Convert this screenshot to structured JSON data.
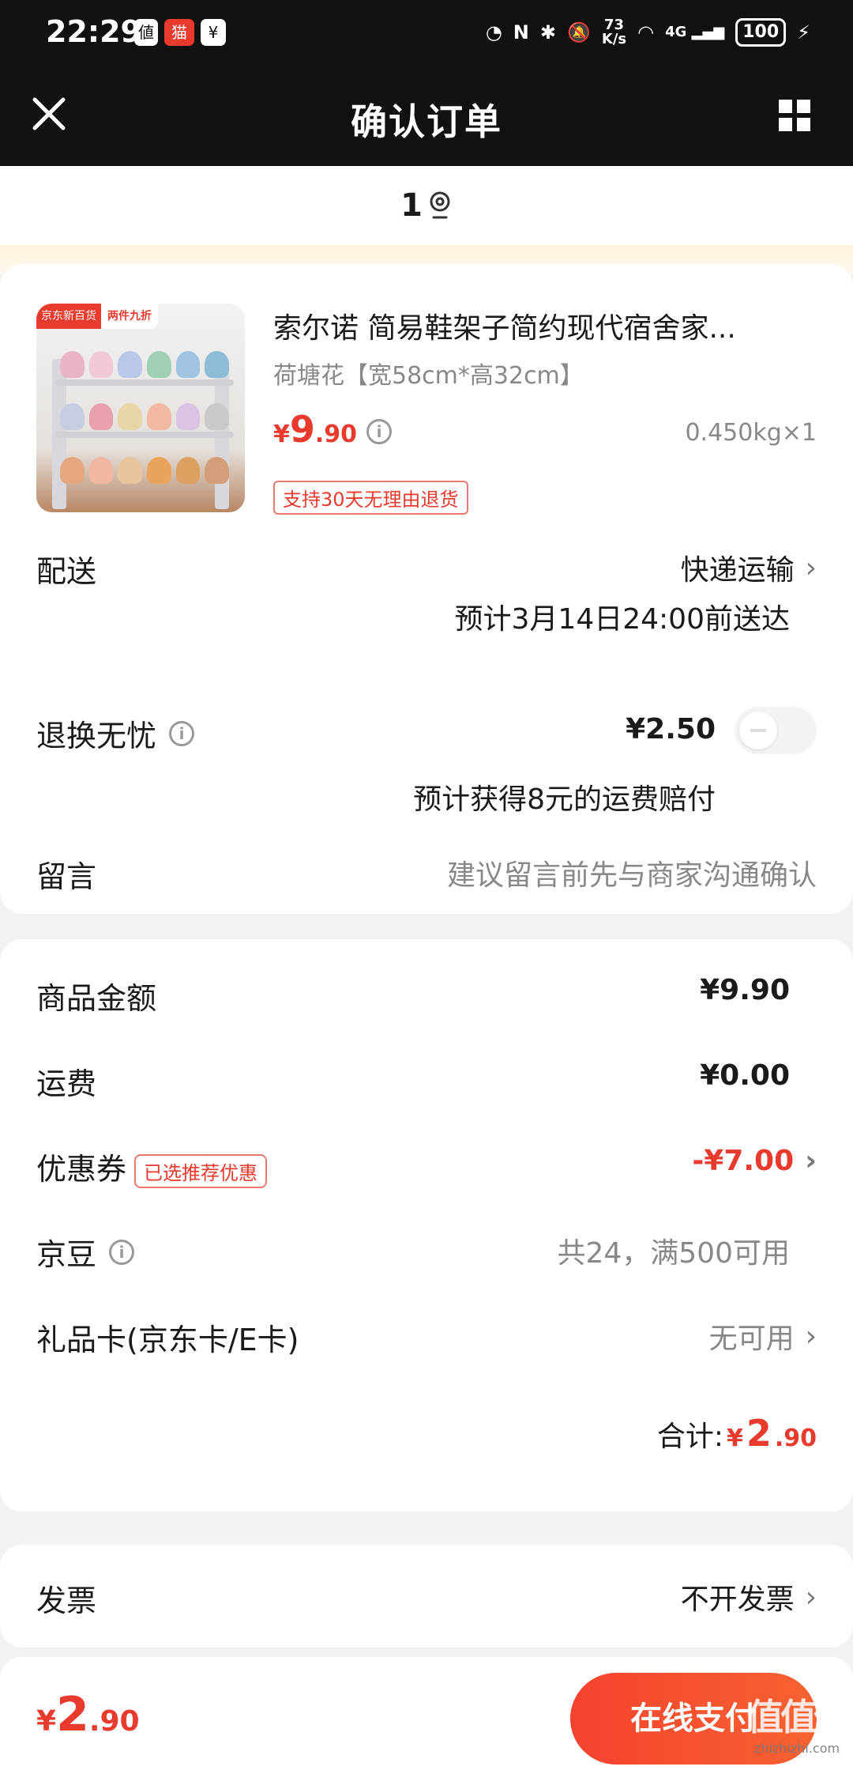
{
  "status_bar": {
    "time": "22:29",
    "net_speed_value": "73",
    "net_speed_unit": "K/s",
    "network": "4G",
    "battery": "100"
  },
  "header": {
    "title": "确认订单"
  },
  "address": {
    "text": "1"
  },
  "product": {
    "image_tag_brand": "京东新百货",
    "image_tag_promo": "两件九折",
    "title": "索尔诺 简易鞋架子简约现代宿舍家...",
    "spec": "荷塘花【宽58cm*高32cm】",
    "price_symbol": "¥",
    "price_int": "9",
    "price_dec": ".90",
    "weight_qty": "0.450kg×1",
    "return_policy": "支持30天无理由退货"
  },
  "delivery": {
    "label": "配送",
    "method": "快递运输",
    "eta": "预计3月14日24:00前送达"
  },
  "return_insurance": {
    "label": "退换无忧",
    "price": "¥2.50",
    "note": "预计获得8元的运费赔付",
    "enabled": false
  },
  "message": {
    "label": "留言",
    "placeholder": "建议留言前先与商家沟通确认"
  },
  "summary": {
    "goods_label": "商品金额",
    "goods_value": "¥9.90",
    "shipping_label": "运费",
    "shipping_value": "¥0.00",
    "coupon_label": "优惠券",
    "coupon_badge": "已选推荐优惠",
    "coupon_value": "-¥7.00",
    "jingdou_label": "京豆",
    "jingdou_value": "共24，满500可用",
    "giftcard_label": "礼品卡(京东卡/E卡)",
    "giftcard_value": "无可用",
    "total_label": "合计:",
    "total_symbol": "¥",
    "total_int": "2",
    "total_dec": ".90"
  },
  "invoice": {
    "label": "发票",
    "value": "不开发票"
  },
  "bottom_bar": {
    "total_symbol": "¥",
    "total_int": "2",
    "total_dec": ".90",
    "pay_button": "在线支付"
  },
  "watermark": {
    "big": "值值值",
    "small": "zhizhizhi.com"
  },
  "colors": {
    "accent": "#e93a2e",
    "header_bg": "#111111",
    "page_bg": "#f2f2f2"
  }
}
